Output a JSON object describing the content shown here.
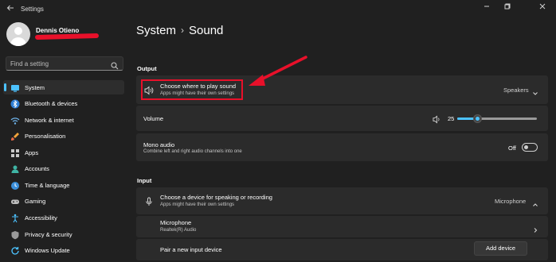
{
  "window": {
    "title": "Settings",
    "back_icon": "back-arrow-icon",
    "controls": [
      "minimize-icon",
      "maximize-icon",
      "close-icon"
    ]
  },
  "user": {
    "name": "Dennis Otieno",
    "avatar_icon": "user-avatar-icon"
  },
  "search": {
    "placeholder": "Find a setting",
    "icon": "search-icon"
  },
  "sidebar": {
    "accent": "#4cc2ff",
    "items": [
      {
        "label": "System",
        "icon": "system-icon",
        "active": true
      },
      {
        "label": "Bluetooth & devices",
        "icon": "bluetooth-icon"
      },
      {
        "label": "Network & internet",
        "icon": "wifi-icon"
      },
      {
        "label": "Personalisation",
        "icon": "brush-icon"
      },
      {
        "label": "Apps",
        "icon": "apps-icon"
      },
      {
        "label": "Accounts",
        "icon": "accounts-icon"
      },
      {
        "label": "Time & language",
        "icon": "globe-clock-icon"
      },
      {
        "label": "Gaming",
        "icon": "gamepad-icon"
      },
      {
        "label": "Accessibility",
        "icon": "accessibility-icon"
      },
      {
        "label": "Privacy & security",
        "icon": "shield-icon"
      },
      {
        "label": "Windows Update",
        "icon": "update-icon"
      }
    ]
  },
  "breadcrumb": {
    "parent": "System",
    "separator": "›",
    "current": "Sound"
  },
  "output": {
    "section_label": "Output",
    "choose_title": "Choose where to play sound",
    "choose_subtitle": "Apps might have their own settings",
    "choose_value": "Speakers",
    "volume_label": "Volume",
    "volume_value": "25",
    "volume_level": 0.25,
    "mono_title": "Mono audio",
    "mono_subtitle": "Combine left and right audio channels into one",
    "mono_state": "Off"
  },
  "input": {
    "section_label": "Input",
    "choose_title": "Choose a device for speaking or recording",
    "choose_subtitle": "Apps might have their own settings",
    "choose_value": "Microphone",
    "device_title": "Microphone",
    "device_subtitle": "Realtek(R) Audio",
    "pair_label": "Pair a new input device",
    "add_button": "Add device"
  },
  "annotation": {
    "color": "#e8102a"
  }
}
